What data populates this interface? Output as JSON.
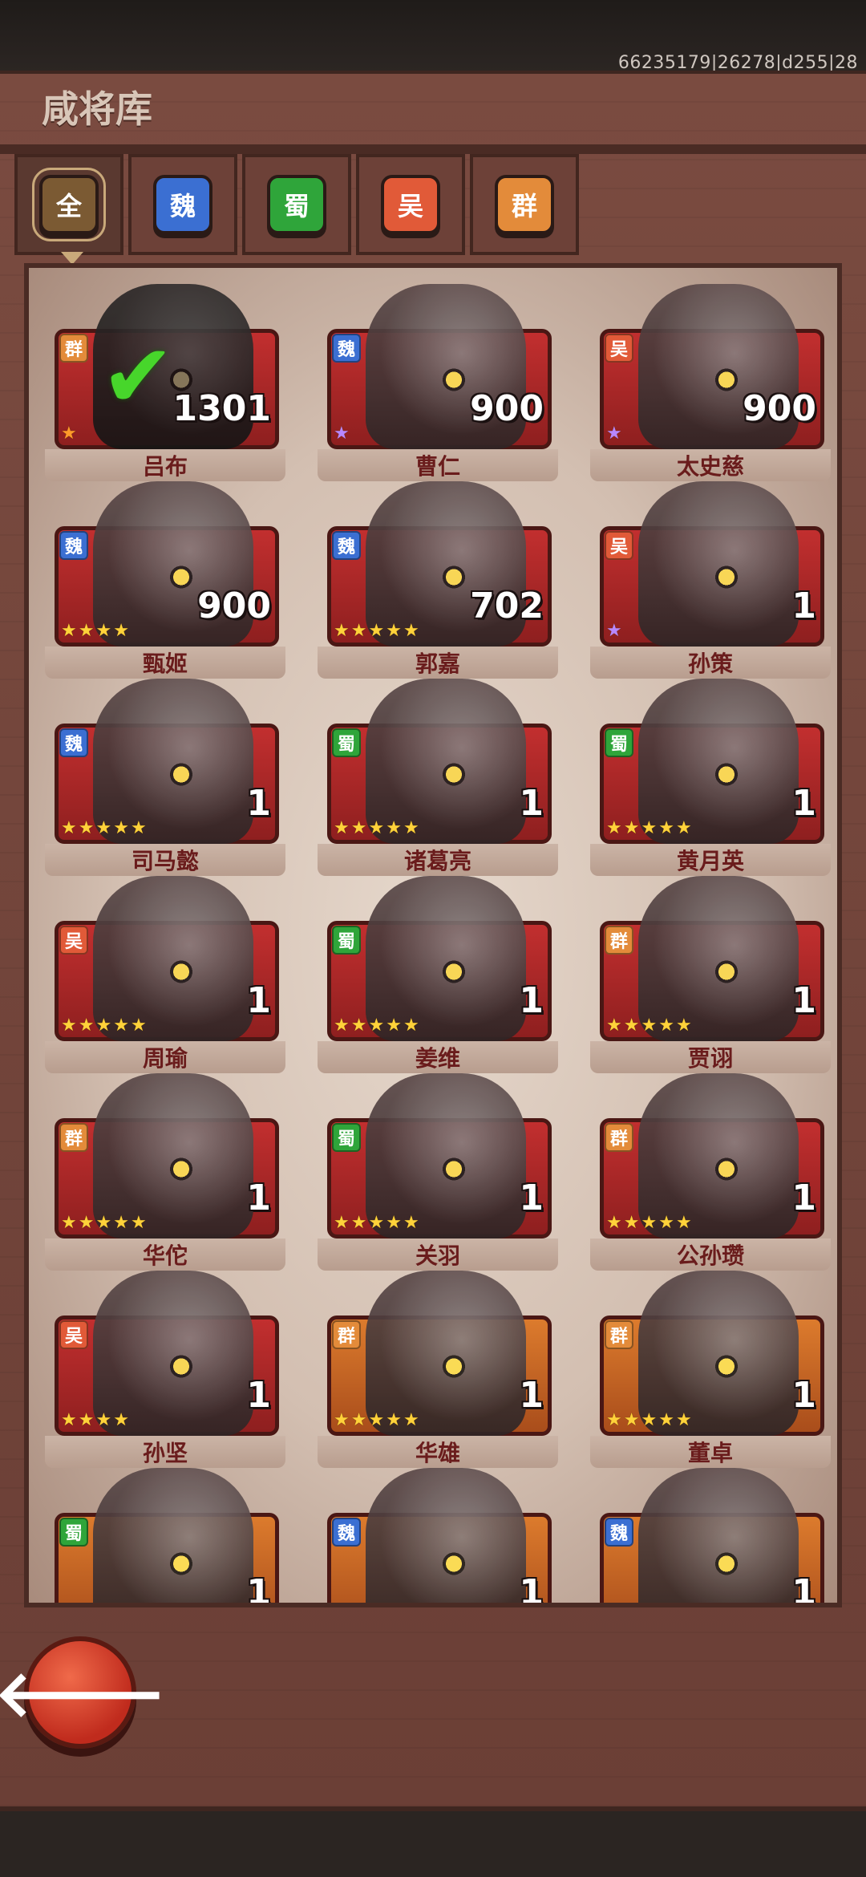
{
  "build_id": "66235179|26278|d255|28",
  "title": "咸将库",
  "tabs": [
    {
      "label": "全",
      "color": "#7b5a33",
      "active": true
    },
    {
      "label": "魏",
      "color": "#3b6fd2",
      "active": false
    },
    {
      "label": "蜀",
      "color": "#2fa53a",
      "active": false
    },
    {
      "label": "吴",
      "color": "#e15a38",
      "active": false
    },
    {
      "label": "群",
      "color": "#e38b3a",
      "active": false
    }
  ],
  "faction_colors": {
    "魏": "#3b6fd2",
    "蜀": "#2fa53a",
    "吴": "#e15a38",
    "群": "#e38b3a"
  },
  "heroes": [
    {
      "name": "吕布",
      "faction": "群",
      "count": "1301",
      "stars": 1,
      "star_color": "orange",
      "owned_check": true,
      "frame": "red"
    },
    {
      "name": "曹仁",
      "faction": "魏",
      "count": "900",
      "stars": 1,
      "star_color": "purple",
      "owned_check": false,
      "frame": "red"
    },
    {
      "name": "太史慈",
      "faction": "吴",
      "count": "900",
      "stars": 1,
      "star_color": "purple",
      "owned_check": false,
      "frame": "red"
    },
    {
      "name": "甄姬",
      "faction": "魏",
      "count": "900",
      "stars": 4,
      "star_color": "gold",
      "owned_check": false,
      "frame": "red"
    },
    {
      "name": "郭嘉",
      "faction": "魏",
      "count": "702",
      "stars": 5,
      "star_color": "gold",
      "owned_check": false,
      "frame": "red"
    },
    {
      "name": "孙策",
      "faction": "吴",
      "count": "1",
      "stars": 1,
      "star_color": "purple",
      "owned_check": false,
      "frame": "red"
    },
    {
      "name": "司马懿",
      "faction": "魏",
      "count": "1",
      "stars": 5,
      "star_color": "gold",
      "owned_check": false,
      "frame": "red"
    },
    {
      "name": "诸葛亮",
      "faction": "蜀",
      "count": "1",
      "stars": 5,
      "star_color": "gold",
      "owned_check": false,
      "frame": "red"
    },
    {
      "name": "黄月英",
      "faction": "蜀",
      "count": "1",
      "stars": 5,
      "star_color": "gold",
      "owned_check": false,
      "frame": "red"
    },
    {
      "name": "周瑜",
      "faction": "吴",
      "count": "1",
      "stars": 5,
      "star_color": "gold",
      "owned_check": false,
      "frame": "red"
    },
    {
      "name": "姜维",
      "faction": "蜀",
      "count": "1",
      "stars": 5,
      "star_color": "gold",
      "owned_check": false,
      "frame": "red"
    },
    {
      "name": "贾诩",
      "faction": "群",
      "count": "1",
      "stars": 5,
      "star_color": "gold",
      "owned_check": false,
      "frame": "red"
    },
    {
      "name": "华佗",
      "faction": "群",
      "count": "1",
      "stars": 5,
      "star_color": "gold",
      "owned_check": false,
      "frame": "red"
    },
    {
      "name": "关羽",
      "faction": "蜀",
      "count": "1",
      "stars": 5,
      "star_color": "gold",
      "owned_check": false,
      "frame": "red"
    },
    {
      "name": "公孙瓒",
      "faction": "群",
      "count": "1",
      "stars": 5,
      "star_color": "gold",
      "owned_check": false,
      "frame": "red"
    },
    {
      "name": "孙坚",
      "faction": "吴",
      "count": "1",
      "stars": 4,
      "star_color": "gold",
      "owned_check": false,
      "frame": "red"
    },
    {
      "name": "华雄",
      "faction": "群",
      "count": "1",
      "stars": 5,
      "star_color": "gold",
      "owned_check": false,
      "frame": "gold"
    },
    {
      "name": "董卓",
      "faction": "群",
      "count": "1",
      "stars": 5,
      "star_color": "gold",
      "owned_check": false,
      "frame": "gold"
    },
    {
      "name": "",
      "faction": "蜀",
      "count": "1",
      "stars": 0,
      "star_color": "gold",
      "owned_check": false,
      "frame": "gold"
    },
    {
      "name": "",
      "faction": "魏",
      "count": "1",
      "stars": 0,
      "star_color": "gold",
      "owned_check": false,
      "frame": "gold"
    },
    {
      "name": "",
      "faction": "魏",
      "count": "1",
      "stars": 0,
      "star_color": "gold",
      "owned_check": false,
      "frame": "gold"
    }
  ],
  "back_button": {
    "icon": "arrow-left-icon",
    "glyph": "🡐"
  }
}
